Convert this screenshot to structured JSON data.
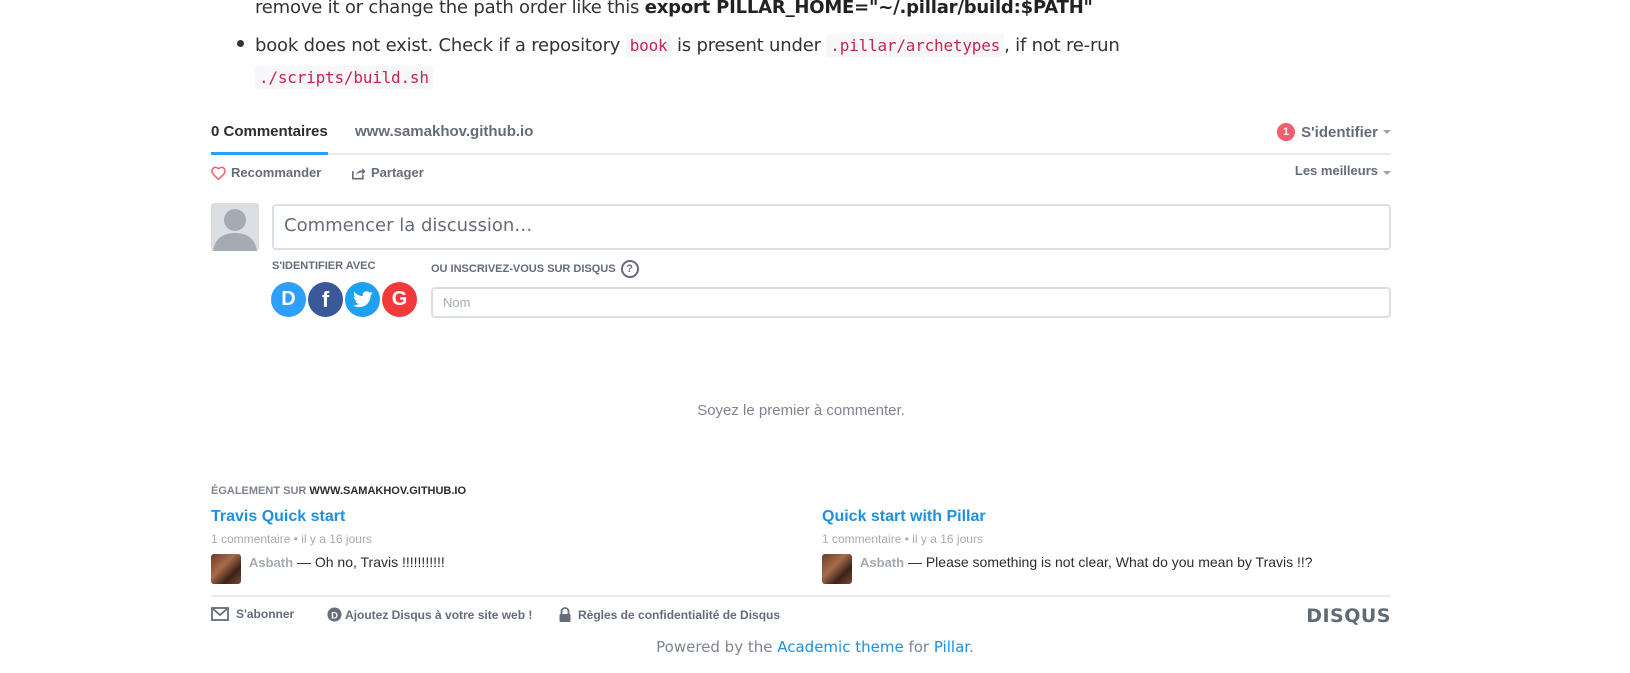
{
  "article": {
    "line1_prefix": "remove it or change the path order like this ",
    "line1_bold": "export PILLAR_HOME=\"~/.pillar/build:$PATH\"",
    "bullet2_part1": "book does not exist. Check if a repository ",
    "bullet2_code1": "book",
    "bullet2_part2": " is present under ",
    "bullet2_code2": ".pillar/archetypes",
    "bullet2_part3": ", if not re-run",
    "bullet2_code3": "./scripts/build.sh"
  },
  "disqus": {
    "tab_comments": "0 Commentaires",
    "tab_site": "www.samakhov.github.io",
    "notification_count": "1",
    "signin_label": "S'identifier",
    "recommend_label": "Recommander",
    "share_label": "Partager",
    "sort_label": "Les meilleurs",
    "compose_placeholder": "Commencer la discussion…",
    "login_with_label": "S'IDENTIFIER AVEC",
    "register_label": "OU INSCRIVEZ-VOUS SUR DISQUS",
    "help_glyph": "?",
    "name_placeholder": "Nom",
    "social": {
      "disqus": "D",
      "facebook": "f",
      "google": "G"
    },
    "empty_message": "Soyez le premier à commenter.",
    "also_prefix": "ÉGALEMENT SUR ",
    "also_site": "WWW.SAMAKHOV.GITHUB.IO",
    "recommendations": [
      {
        "title": "Travis Quick start",
        "meta": "1 commentaire • il y a 16 jours",
        "author": "Asbath",
        "excerpt": " — Oh no, Travis !!!!!!!!!!!"
      },
      {
        "title": "Quick start with Pillar",
        "meta": "1 commentaire • il y a 16 jours",
        "author": "Asbath",
        "excerpt": " — Please something is not clear, What do you mean by Travis !!?"
      }
    ],
    "footer": {
      "subscribe": "S'abonner",
      "add_disqus": "Ajoutez Disqus à votre site web !",
      "privacy": "Règles de confidentialité de Disqus",
      "logo": "DISQUS"
    }
  },
  "powered": {
    "prefix": "Powered by the ",
    "theme_link": "Academic theme",
    "middle": " for ",
    "pillar_link": "Pillar",
    "suffix": "."
  },
  "colors": {
    "accent": "#2e9fff",
    "link": "#1e90e0",
    "badge": "#f05f70"
  }
}
